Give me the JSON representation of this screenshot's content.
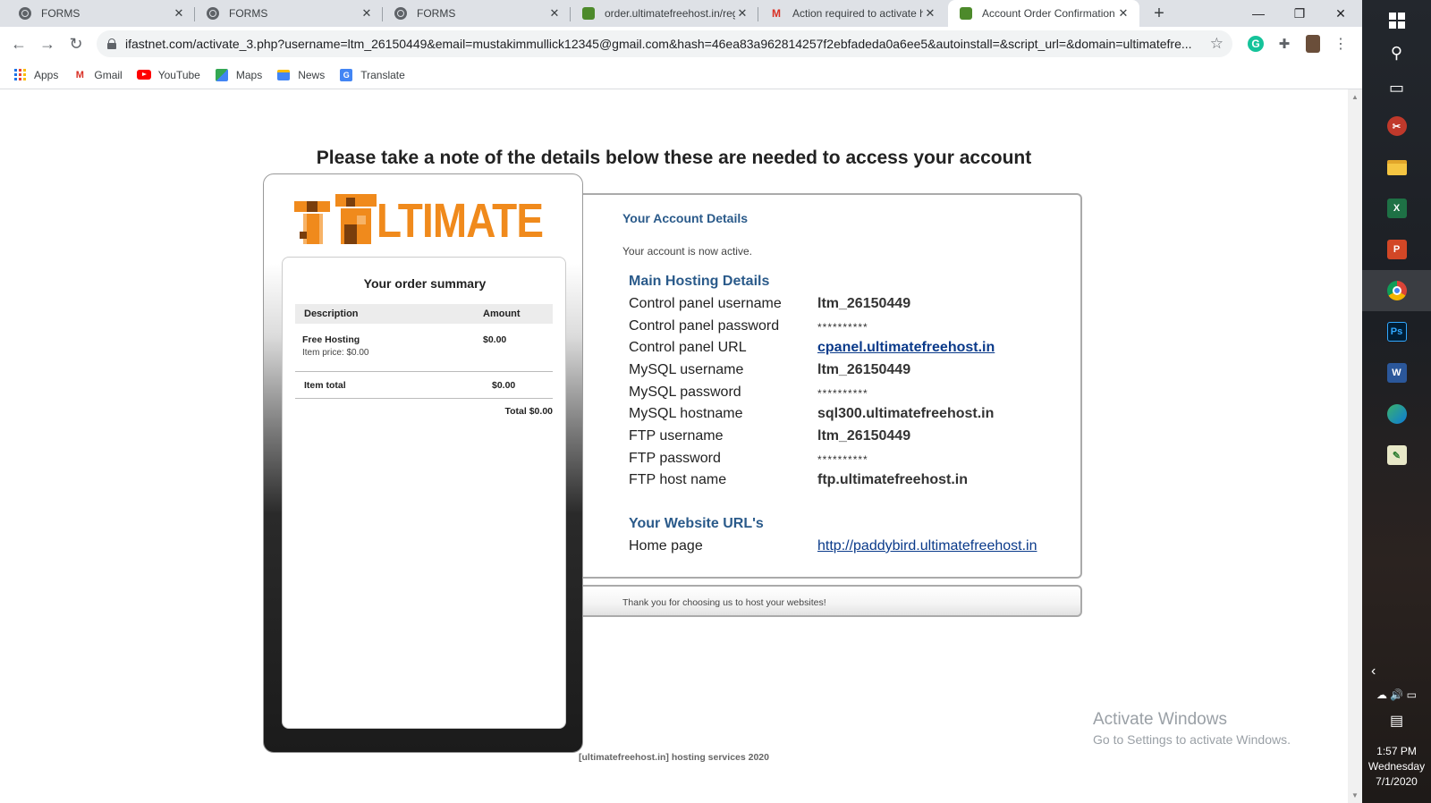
{
  "browser": {
    "tabs": [
      {
        "title": "FORMS",
        "icon": "globe-icon"
      },
      {
        "title": "FORMS",
        "icon": "globe-icon"
      },
      {
        "title": "FORMS",
        "icon": "globe-icon"
      },
      {
        "title": "order.ultimatefreehost.in/reg",
        "icon": "site-icon"
      },
      {
        "title": "Action required to activate h",
        "icon": "gmail-icon"
      },
      {
        "title": "Account Order Confirmation",
        "icon": "site-icon",
        "active": true
      }
    ],
    "new_tab": "+",
    "url": "ifastnet.com/activate_3.php?username=ltm_26150449&email=mustakimmullick12345@gmail.com&hash=46ea83a962814257f2ebfadeda0a6ee5&autoinstall=&script_url=&domain=ultimatefre...",
    "bookmarks": [
      "Apps",
      "Gmail",
      "YouTube",
      "Maps",
      "News",
      "Translate"
    ]
  },
  "page": {
    "headline": "Please take a note of the details below these are needed to access your account",
    "logo_text": "LTIMATE",
    "order": {
      "title": "Your order summary",
      "col_description": "Description",
      "col_amount": "Amount",
      "item_name": "Free Hosting",
      "item_price": "Item price: $0.00",
      "item_amount": "$0.00",
      "item_total_label": "Item total",
      "item_total_value": "$0.00",
      "grand_total": "Total $0.00"
    },
    "details": {
      "title": "Your Account Details",
      "status": "Your account is now active.",
      "hosting_section": "Main Hosting Details",
      "rows": [
        {
          "label": "Control panel username",
          "value": "ltm_26150449"
        },
        {
          "label": "Control panel password",
          "value": "**********"
        },
        {
          "label": "Control panel URL",
          "value": "cpanel.ultimatefreehost.in"
        },
        {
          "label": "MySQL username",
          "value": "ltm_26150449"
        },
        {
          "label": "MySQL password",
          "value": "**********"
        },
        {
          "label": "MySQL hostname",
          "value": "sql300.ultimatefreehost.in"
        },
        {
          "label": "FTP username",
          "value": "ltm_26150449"
        },
        {
          "label": "FTP password",
          "value": "**********"
        },
        {
          "label": "FTP host name",
          "value": "ftp.ultimatefreehost.in"
        }
      ],
      "website_section": "Your Website URL's",
      "home_label": "Home page",
      "home_value": "http://paddybird.ultimatefreehost.in"
    },
    "thanks": "Thank you for choosing us to host your websites!",
    "footer": "[ultimatefreehost.in] hosting services 2020"
  },
  "watermark": {
    "line1": "Activate Windows",
    "line2": "Go to Settings to activate Windows."
  },
  "taskbar": {
    "time": "1:57 PM",
    "day": "Wednesday",
    "date": "7/1/2020"
  }
}
